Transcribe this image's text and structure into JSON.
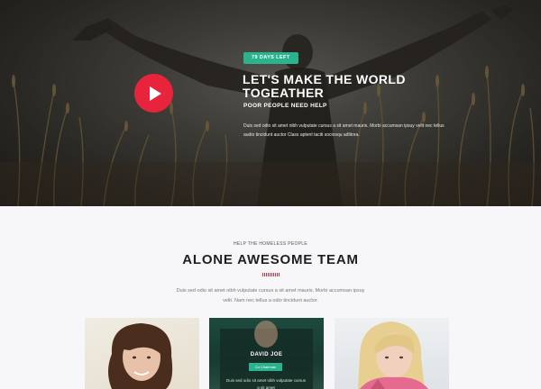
{
  "hero": {
    "badge": "79 DAYS LEFT",
    "title": "LET'S MAKE THE WORLD TOGEATHER",
    "subtitle": "POOR PEOPLE NEED HELP",
    "text": "Duis sed odio sit amet nibh vulputate cursus a sit amet mauris. Morbi accumsan ipsuy velit nec tellus audio tincidunt auctor Class aptent taciti sociosqu adlitora.",
    "play_icon": "play-icon",
    "colors": {
      "play": "#e8243c",
      "badge": "#2bb38e"
    }
  },
  "team_section": {
    "kicker": "HELP THE HOMELESS PEOPLE",
    "title": "ALONE AWESOME TEAM",
    "description": "Duis sed odio sit amet nibh vulputate cursus a sit amet mauris. Morbi accumsan ipsuy velit. Nam nec tellus a odio tincidunt auctor.",
    "accent": "#e8243c"
  },
  "team": [
    {
      "name": "",
      "role": "",
      "text": ""
    },
    {
      "name": "DAVID JOE",
      "role": "Co Chairman",
      "text": "Duis sed odio sit amet nibh vulputate cursus a sit amet"
    },
    {
      "name": "",
      "role": "",
      "text": ""
    }
  ]
}
